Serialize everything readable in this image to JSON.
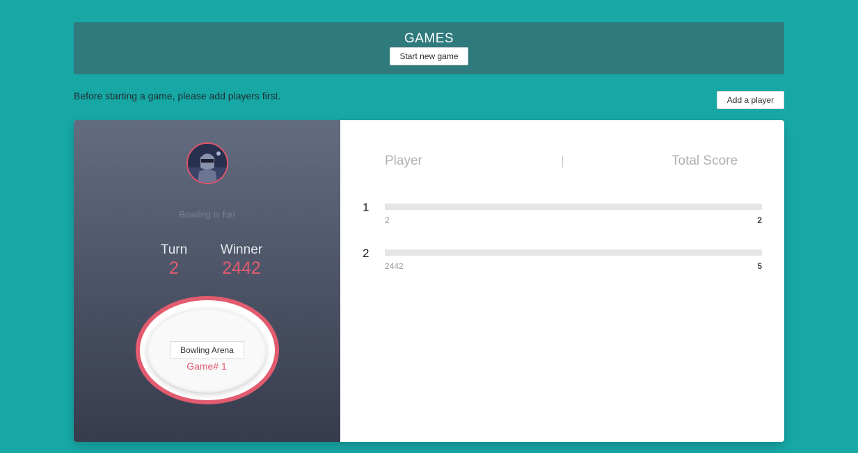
{
  "header": {
    "title": "GAMES",
    "start_button": "Start new game"
  },
  "notice": "Before starting a game, please add players first.",
  "add_player_button": "Add a player",
  "game_card": {
    "tagline": "Bowling is fun",
    "turn_label": "Turn",
    "turn_value": "2",
    "winner_label": "Winner",
    "winner_value": "2442",
    "arena_button": "Bowling Arena",
    "game_number": "Game# 1",
    "accent_color": "#e25b6e"
  },
  "scoreboard": {
    "player_header": "Player",
    "score_header": "Total Score",
    "rows": [
      {
        "rank": "1",
        "name": "2",
        "score": "2"
      },
      {
        "rank": "2",
        "name": "2442",
        "score": "5"
      }
    ]
  }
}
